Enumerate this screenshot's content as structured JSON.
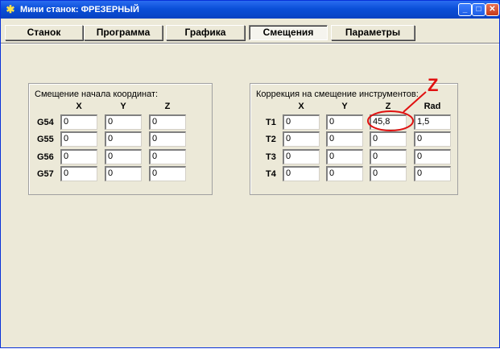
{
  "window": {
    "title": "Мини станок:  ФРЕЗЕРНЫЙ",
    "minimize": "_",
    "maximize": "□",
    "close": "✕"
  },
  "tabs": [
    {
      "label": "Станок"
    },
    {
      "label": "Программа"
    },
    {
      "label": "Графика"
    },
    {
      "label": "Смещения"
    },
    {
      "label": "Параметры"
    }
  ],
  "active_tab": "Смещения",
  "offsets": {
    "title": "Смещение начала координат:",
    "columns": [
      "X",
      "Y",
      "Z"
    ],
    "rows": [
      {
        "label": "G54",
        "values": [
          "0",
          "0",
          "0"
        ]
      },
      {
        "label": "G55",
        "values": [
          "0",
          "0",
          "0"
        ]
      },
      {
        "label": "G56",
        "values": [
          "0",
          "0",
          "0"
        ]
      },
      {
        "label": "G57",
        "values": [
          "0",
          "0",
          "0"
        ]
      }
    ]
  },
  "tool_offsets": {
    "title": "Коррекция на смещение инструментов:",
    "columns": [
      "X",
      "Y",
      "Z",
      "Rad"
    ],
    "rows": [
      {
        "label": "T1",
        "values": [
          "0",
          "0",
          "45,8",
          "1,5"
        ]
      },
      {
        "label": "T2",
        "values": [
          "0",
          "0",
          "0",
          "0"
        ]
      },
      {
        "label": "T3",
        "values": [
          "0",
          "0",
          "0",
          "0"
        ]
      },
      {
        "label": "T4",
        "values": [
          "0",
          "0",
          "0",
          "0"
        ]
      }
    ]
  },
  "annotation": {
    "label": "Z",
    "color": "#e01010"
  }
}
